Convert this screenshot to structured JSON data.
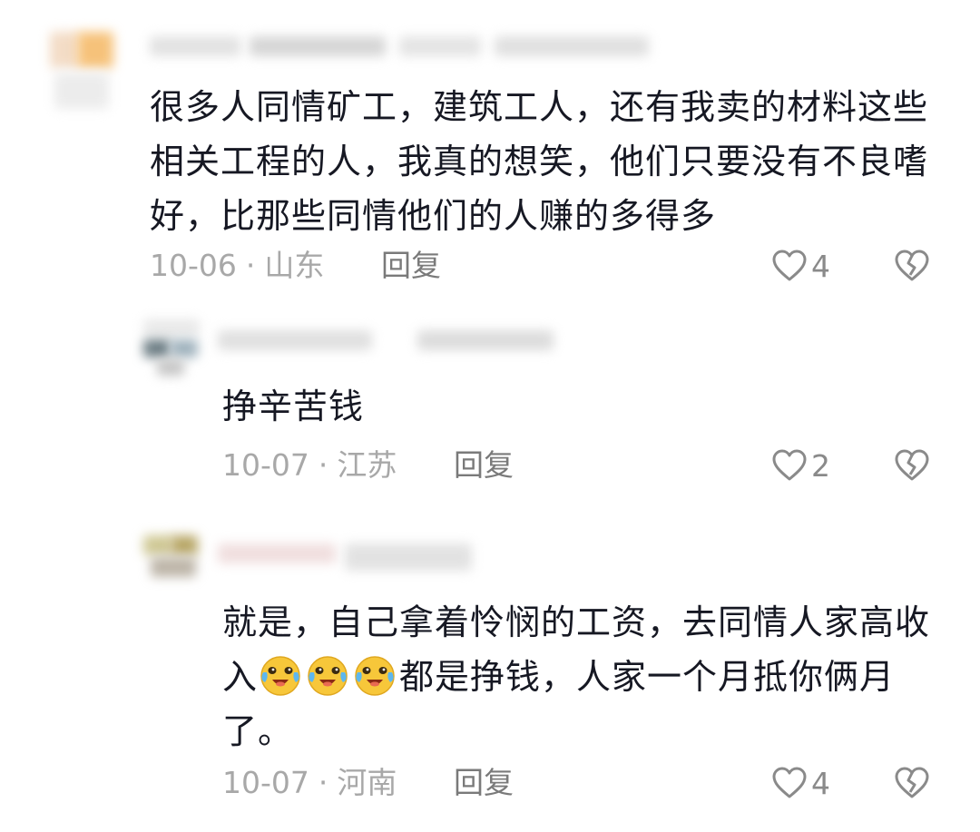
{
  "comments": [
    {
      "text": "很多人同情矿工，建筑工人，还有我卖的材料这些相关工程的人，我真的想笑，他们只要没有不良嗜好，比那些同情他们的人赚的多得多",
      "date": "10-06",
      "location": "山东",
      "reply_label": "回复",
      "likes": "4"
    },
    {
      "text": "挣辛苦钱",
      "date": "10-07",
      "location": "江苏",
      "reply_label": "回复",
      "likes": "2"
    },
    {
      "text_before": "就是，自己拿着怜悯的工资，去同情人家高收入",
      "emoji_count": 3,
      "emoji_name": "crying-laughing-emoji",
      "text_after": "都是挣钱，人家一个月抵你俩月了。",
      "date": "10-07",
      "location": "河南",
      "reply_label": "回复",
      "likes": "4"
    }
  ],
  "meta_separator": "·",
  "icons": {
    "like": "heart-outline-icon",
    "dislike": "broken-heart-icon"
  },
  "colors": {
    "text": "#161823",
    "meta": "#a8a8a8",
    "icon": "#8a8a8a"
  }
}
